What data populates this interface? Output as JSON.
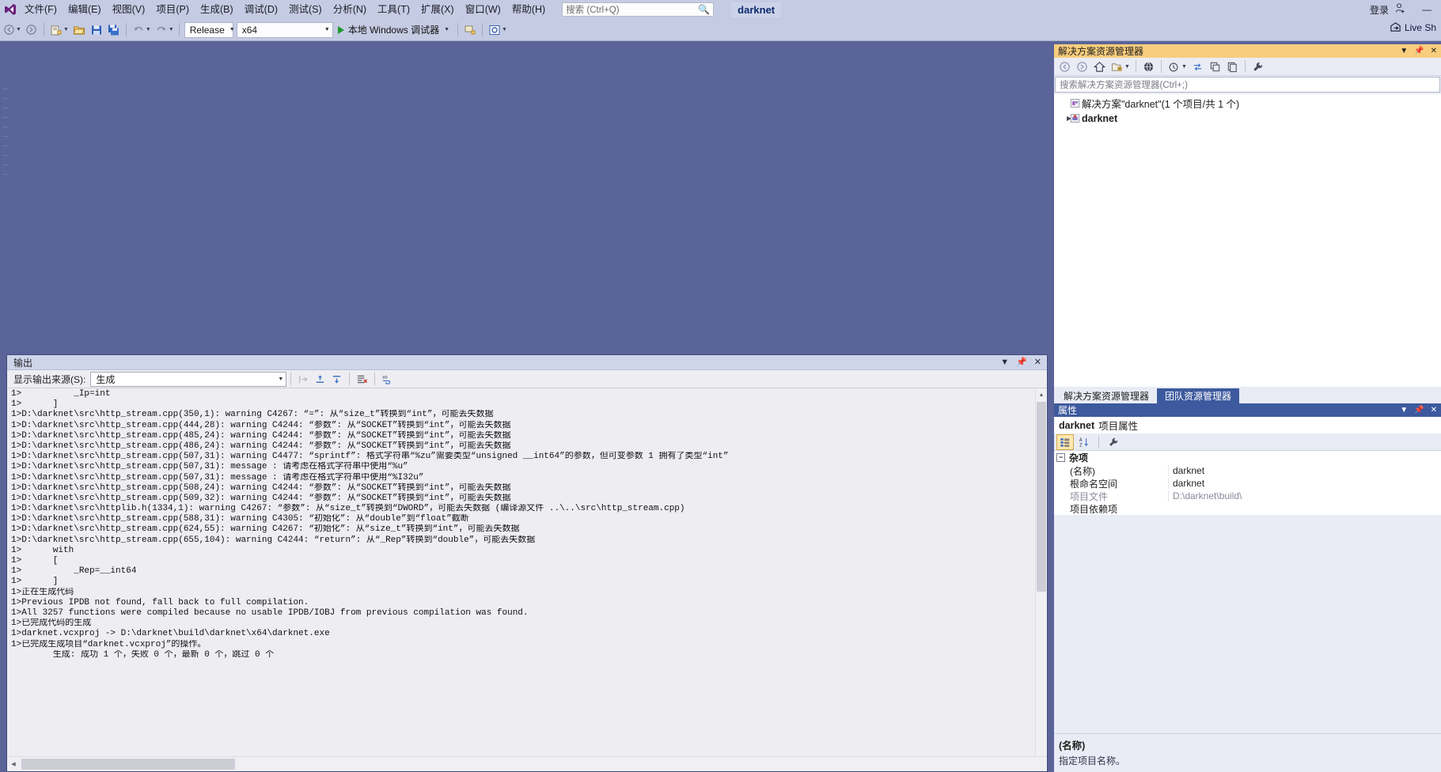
{
  "app": {
    "solution_name": "darknet",
    "logo_name": "visual-studio-logo"
  },
  "menubar": {
    "items": [
      {
        "label": "文件(F)",
        "name": "menu-file"
      },
      {
        "label": "编辑(E)",
        "name": "menu-edit"
      },
      {
        "label": "视图(V)",
        "name": "menu-view"
      },
      {
        "label": "项目(P)",
        "name": "menu-project"
      },
      {
        "label": "生成(B)",
        "name": "menu-build"
      },
      {
        "label": "调试(D)",
        "name": "menu-debug"
      },
      {
        "label": "测试(S)",
        "name": "menu-test"
      },
      {
        "label": "分析(N)",
        "name": "menu-analyze"
      },
      {
        "label": "工具(T)",
        "name": "menu-tools"
      },
      {
        "label": "扩展(X)",
        "name": "menu-extensions"
      },
      {
        "label": "窗口(W)",
        "name": "menu-window"
      },
      {
        "label": "帮助(H)",
        "name": "menu-help"
      }
    ],
    "search_placeholder": "搜索 (Ctrl+Q)",
    "signin_label": "登录",
    "minimize_label": "—"
  },
  "toolbar": {
    "configuration": "Release",
    "platform": "x64",
    "debug_target": "本地 Windows 调试器",
    "liveshare_label": "Live Sh"
  },
  "output": {
    "title": "输出",
    "source_label": "显示输出来源(S):",
    "source_value": "生成",
    "lines": [
      "1>          _Ip=int",
      "1>      ]",
      "1>D:\\darknet\\src\\http_stream.cpp(350,1): warning C4267: “=”: 从“size_t”转换到“int”，可能丢失数据",
      "1>D:\\darknet\\src\\http_stream.cpp(444,28): warning C4244: “参数”: 从“SOCKET”转换到“int”，可能丢失数据",
      "1>D:\\darknet\\src\\http_stream.cpp(485,24): warning C4244: “参数”: 从“SOCKET”转换到“int”，可能丢失数据",
      "1>D:\\darknet\\src\\http_stream.cpp(486,24): warning C4244: “参数”: 从“SOCKET”转换到“int”，可能丢失数据",
      "1>D:\\darknet\\src\\http_stream.cpp(507,31): warning C4477: “sprintf”: 格式字符串“%zu”需要类型“unsigned __int64”的参数，但可变参数 1 拥有了类型“int”",
      "1>D:\\darknet\\src\\http_stream.cpp(507,31): message : 请考虑在格式字符串中使用“%u”",
      "1>D:\\darknet\\src\\http_stream.cpp(507,31): message : 请考虑在格式字符串中使用“%I32u”",
      "1>D:\\darknet\\src\\http_stream.cpp(508,24): warning C4244: “参数”: 从“SOCKET”转换到“int”，可能丢失数据",
      "1>D:\\darknet\\src\\http_stream.cpp(509,32): warning C4244: “参数”: 从“SOCKET”转换到“int”，可能丢失数据",
      "1>D:\\darknet\\src\\httplib.h(1334,1): warning C4267: “参数”: 从“size_t”转换到“DWORD”，可能丢失数据 (编译源文件 ..\\..\\src\\http_stream.cpp)",
      "1>D:\\darknet\\src\\http_stream.cpp(588,31): warning C4305: “初始化”: 从“double”到“float”截断",
      "1>D:\\darknet\\src\\http_stream.cpp(624,55): warning C4267: “初始化”: 从“size_t”转换到“int”，可能丢失数据",
      "1>D:\\darknet\\src\\http_stream.cpp(655,104): warning C4244: “return”: 从“_Rep”转换到“double”，可能丢失数据",
      "1>      with",
      "1>      [",
      "1>          _Rep=__int64",
      "1>      ]",
      "1>正在生成代码",
      "1>Previous IPDB not found, fall back to full compilation.",
      "1>All 3257 functions were compiled because no usable IPDB/IOBJ from previous compilation was found.",
      "1>已完成代码的生成",
      "1>darknet.vcxproj -> D:\\darknet\\build\\darknet\\x64\\darknet.exe",
      "1>已完成生成项目“darknet.vcxproj”的操作。",
      "        生成: 成功 1 个，失败 0 个，最新 0 个，跳过 0 个"
    ]
  },
  "solution_explorer": {
    "title": "解决方案资源管理器",
    "search_placeholder": "搜索解决方案资源管理器(Ctrl+;)",
    "tree": [
      {
        "label": "解决方案\"darknet\"(1 个项目/共 1 个)",
        "icon": "solution-icon",
        "indent": 0,
        "expander": "",
        "bold": false
      },
      {
        "label": "darknet",
        "icon": "project-icon",
        "indent": 1,
        "expander": "▶",
        "bold": true
      }
    ],
    "toolbar_icons": [
      "back-icon",
      "forward-icon",
      "home-icon",
      "new-folder-icon",
      "show-all-files-icon",
      "pending-changes-icon",
      "refresh-icon",
      "collapse-all-icon",
      "properties-page-icon",
      "wrench-icon"
    ]
  },
  "dock_tabs": [
    {
      "label": "解决方案资源管理器",
      "active": false,
      "name": "tab-solution-explorer"
    },
    {
      "label": "团队资源管理器",
      "active": true,
      "name": "tab-team-explorer"
    }
  ],
  "properties": {
    "title": "属性",
    "object_name": "darknet",
    "object_kind": "项目属性",
    "categories": [
      {
        "name": "杂项",
        "rows": [
          {
            "name": "(名称)",
            "value": "darknet",
            "readonly": false
          },
          {
            "name": "根命名空间",
            "value": "darknet",
            "readonly": false
          },
          {
            "name": "项目文件",
            "value": "D:\\darknet\\build\\",
            "readonly": true
          },
          {
            "name": "项目依赖项",
            "value": "",
            "readonly": false
          }
        ]
      }
    ],
    "footer_name": "(名称)",
    "footer_desc": "指定项目名称。"
  },
  "colors": {
    "title_bar": "#c5cbe3",
    "editor_backdrop": "#5a6498",
    "panel_accent": "#f8cd7d",
    "tab_active": "#3d5a9e",
    "output_bg": "#eeeef2"
  }
}
